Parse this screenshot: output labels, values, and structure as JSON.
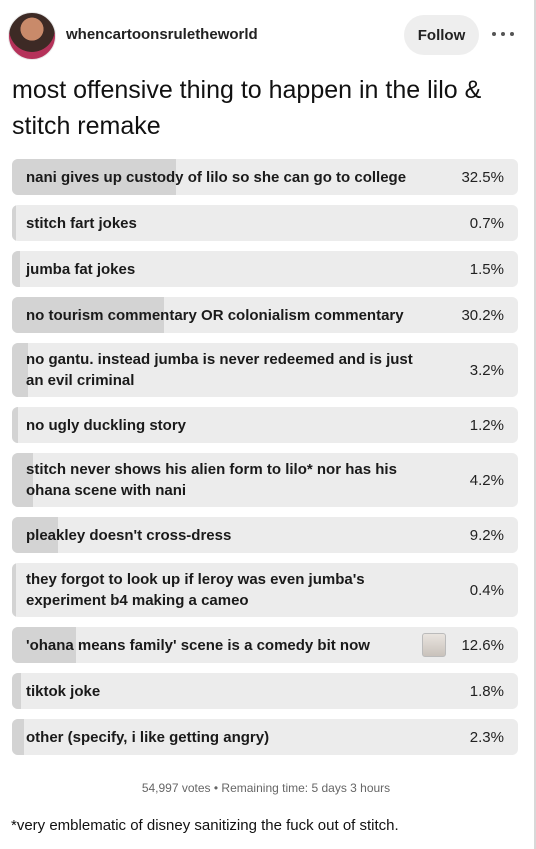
{
  "header": {
    "username": "whencartoonsruletheworld",
    "follow_label": "Follow",
    "more_icon": "more-horizontal-icon"
  },
  "post": {
    "title": "most offensive thing to happen in the lilo & stitch remake",
    "footnote": "*very emblematic of disney sanitizing the fuck out of stitch."
  },
  "poll": {
    "options": [
      {
        "label": "nani gives up custody of lilo so she can go to college",
        "percent": "32.5%",
        "value": 32.5
      },
      {
        "label": "stitch fart jokes",
        "percent": "0.7%",
        "value": 0.7
      },
      {
        "label": "jumba fat jokes",
        "percent": "1.5%",
        "value": 1.5
      },
      {
        "label": "no tourism commentary OR colonialism commentary",
        "percent": "30.2%",
        "value": 30.2
      },
      {
        "label": "no gantu. instead jumba is never redeemed and is just an evil criminal",
        "percent": "3.2%",
        "value": 3.2
      },
      {
        "label": "no ugly duckling story",
        "percent": "1.2%",
        "value": 1.2
      },
      {
        "label": "stitch never shows his alien form to lilo* nor has his ohana scene with nani",
        "percent": "4.2%",
        "value": 4.2
      },
      {
        "label": "pleakley doesn't cross-dress",
        "percent": "9.2%",
        "value": 9.2
      },
      {
        "label": "they forgot to look up if leroy was even jumba's experiment b4 making a cameo",
        "percent": "0.4%",
        "value": 0.4
      },
      {
        "label": "'ohana means family' scene is a comedy bit now",
        "percent": "12.6%",
        "value": 12.6
      },
      {
        "label": "tiktok joke",
        "percent": "1.8%",
        "value": 1.8
      },
      {
        "label": "other (specify, i like getting angry)",
        "percent": "2.3%",
        "value": 2.3
      }
    ],
    "votes": "54,997 votes",
    "separator": "•",
    "remaining": "Remaining time: 5 days 3 hours"
  },
  "colors": {
    "bar_bg": "#ececec",
    "bar_fill": "#d3d3d3"
  }
}
